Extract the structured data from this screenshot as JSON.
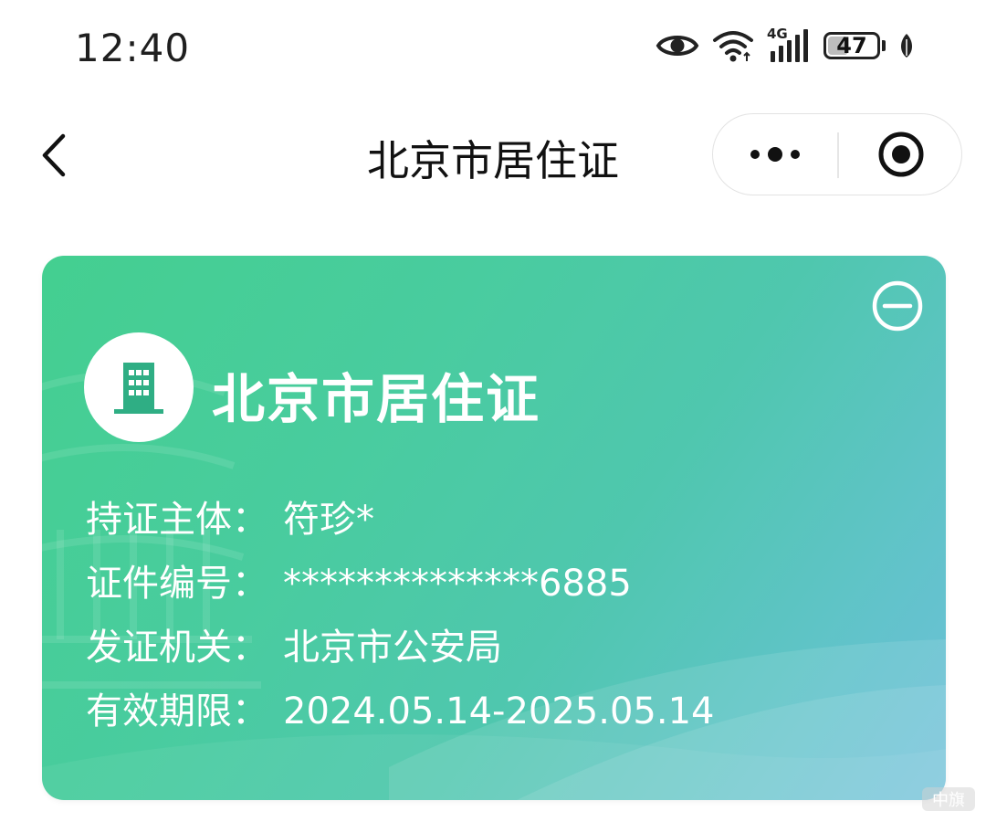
{
  "status_bar": {
    "time": "12:40",
    "network_label": "4G",
    "battery_level": "47",
    "battery_fraction": 0.47,
    "icons": [
      "eye-icon",
      "wifi-icon",
      "signal-icon",
      "battery-icon",
      "leaf-icon"
    ]
  },
  "nav": {
    "title": "北京市居住证",
    "back_icon": "chevron-left-icon",
    "more_icon": "more-dots-icon",
    "close_icon": "target-close-icon"
  },
  "card": {
    "title": "北京市居住证",
    "logo_icon": "building-icon",
    "collapse_icon": "minus-circle-icon",
    "fields": [
      {
        "label": "持证主体：",
        "value": "符珍*"
      },
      {
        "label": "证件编号：",
        "value": "**************6885"
      },
      {
        "label": "发证机关：",
        "value": "北京市公安局"
      },
      {
        "label": "有效期限：",
        "value": "2024.05.14-2025.05.14"
      }
    ],
    "colors": {
      "gradient_start": "#44cf90",
      "gradient_end": "#6dbfd9",
      "logo_icon": "#2fae84"
    }
  },
  "watermark": {
    "text": "中旗"
  }
}
